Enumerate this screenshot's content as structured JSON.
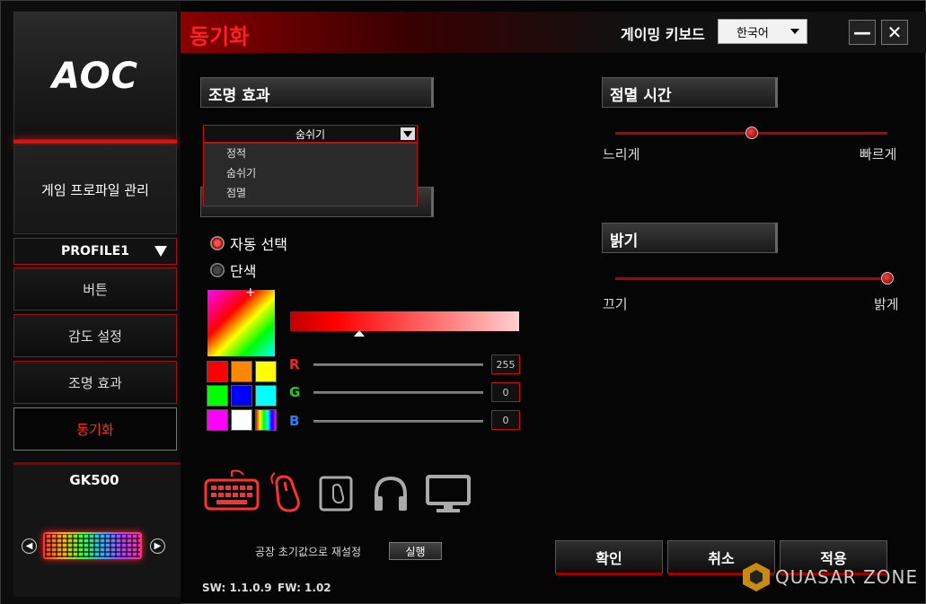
{
  "window": {
    "title": "동기화",
    "header_label": "게이밍 키보드",
    "language": "한국어",
    "minimize_icon": "minimize-icon",
    "close_icon": "close-icon"
  },
  "sidebar": {
    "logo": "AOC",
    "profile_management": "게임 프로파일 관리",
    "profile": "PROFILE1",
    "items": [
      {
        "label": "버튼"
      },
      {
        "label": "감도 설정"
      },
      {
        "label": "조명 효과"
      },
      {
        "label": "동기화",
        "active": true
      }
    ],
    "device": "GK500"
  },
  "lighting": {
    "section_title": "조명 효과",
    "selected": "숨쉬기",
    "options": [
      "정적",
      "숨쉬기",
      "점멸"
    ],
    "radio_auto": "자동 선택",
    "radio_solid": "단색",
    "swatches": [
      "#ff0000",
      "#ff8800",
      "#ffff00",
      "#00ff00",
      "#0000ff",
      "#00ffff",
      "#ff00ff",
      "#ffffff",
      "rainbow"
    ],
    "r_label": "R",
    "g_label": "G",
    "b_label": "B",
    "r": "255",
    "g": "0",
    "b": "0"
  },
  "blink_time": {
    "section_title": "점멸 시간",
    "min_label": "느리게",
    "max_label": "빠르게",
    "value": 0.5
  },
  "brightness": {
    "section_title": "밝기",
    "min_label": "끄기",
    "max_label": "밝게",
    "value": 1.0
  },
  "devices": [
    "keyboard-icon",
    "mouse-icon",
    "mousepad-icon",
    "headset-icon",
    "monitor-icon"
  ],
  "footer": {
    "reset_label": "공장 초기값으로 재설정",
    "run_label": "실행",
    "confirm": "확인",
    "cancel": "취소",
    "apply": "적용",
    "sw": "SW: 1.1.0.9",
    "fw": "FW: 1.02",
    "watermark": "QUASAR ZONE"
  },
  "colors": {
    "accent": "#ff2020",
    "border": "#c01010"
  }
}
